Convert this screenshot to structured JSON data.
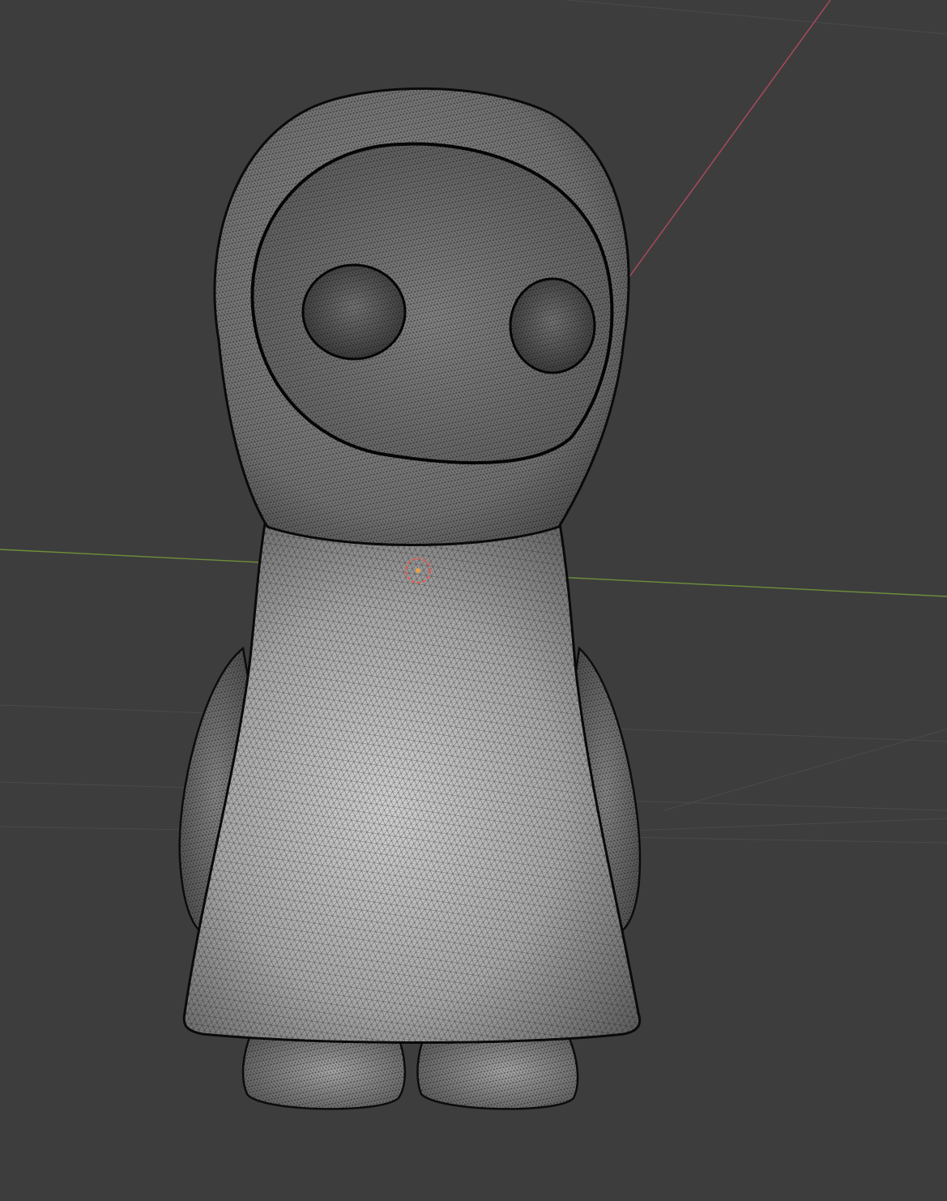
{
  "viewport": {
    "background_color": "#3d3d3d",
    "grid_color": "#4a4a4a",
    "x_axis_color": "#b04a5e",
    "y_axis_color": "#6f8f3a",
    "mesh_base_color": "#9a9a9a",
    "mesh_highlight_color": "#d6d6d6",
    "wire_color": "#111111",
    "origin_marker_color": "#e8584c"
  },
  "scene": {
    "object": "character-mesh",
    "shading_mode": "solid-with-wireframe-overlay",
    "parts": [
      "head",
      "hood-opening",
      "left-eye",
      "right-eye",
      "body",
      "left-arm",
      "right-arm",
      "left-foot",
      "right-foot"
    ],
    "origin_marker": "object-origin-icon"
  }
}
